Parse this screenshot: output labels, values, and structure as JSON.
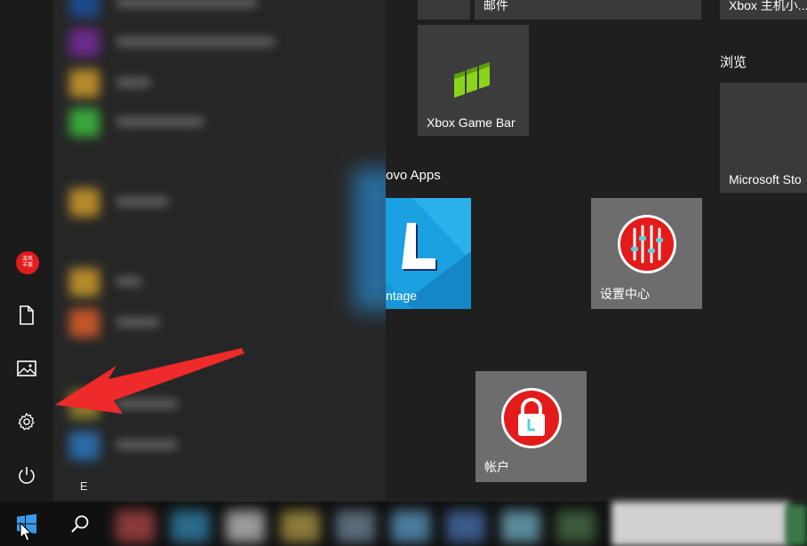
{
  "rail": {
    "avatar_text": "凌风\n羊羹",
    "items": [
      {
        "name": "documents",
        "icon": "document-icon"
      },
      {
        "name": "pictures",
        "icon": "pictures-icon"
      },
      {
        "name": "settings",
        "icon": "gear-icon"
      },
      {
        "name": "power",
        "icon": "power-icon"
      }
    ]
  },
  "applist": {
    "section_letter": "E"
  },
  "tiles": {
    "mail_label": "邮件",
    "xbox_companion_label": "Xbox 主机小...",
    "browse_group_title": "浏览",
    "xbox_game_bar_label": "Xbox Game Bar",
    "microsoft_store_label": "Microsoft Sto",
    "lenovo_group_title": "ovo Apps",
    "vantage_label": "ntage",
    "settings_center_label": "设置中心",
    "account_label": "帐户"
  },
  "colors": {
    "accent_red": "#e31b1b",
    "vantage_blue": "#1ba1e2",
    "tile_gray": "#6d6d6d",
    "xbox_green": "#8bd41c",
    "arrow_red": "#ee2a2a"
  },
  "taskbar": {
    "start_icon": "windows-logo-icon",
    "search_icon": "search-icon"
  }
}
